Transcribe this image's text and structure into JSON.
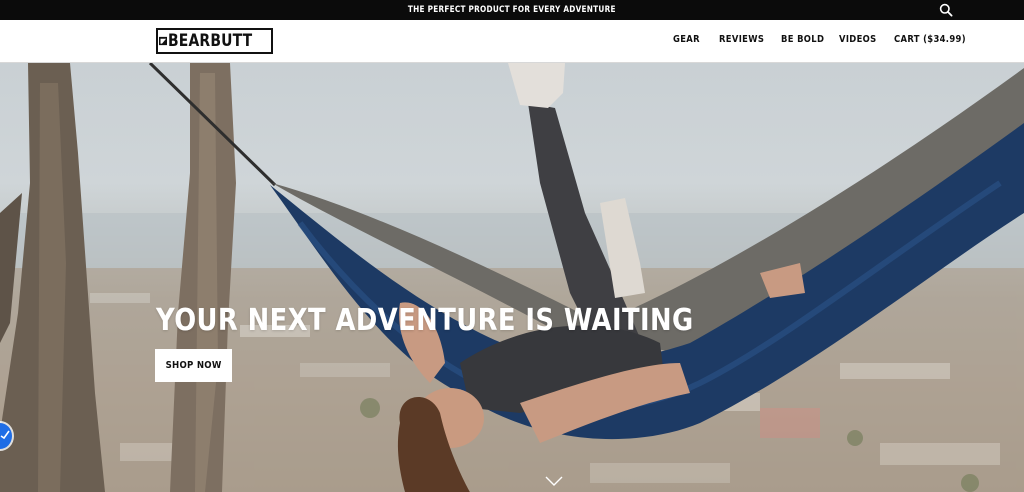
{
  "topbar": {
    "promo_text": "THE PERFECT PRODUCT FOR EVERY ADVENTURE",
    "search_icon": "search-icon",
    "background": "#0b0b0b"
  },
  "header": {
    "logo_text": "BEARBUTT",
    "nav": [
      {
        "label": "GEAR"
      },
      {
        "label": "REVIEWS"
      },
      {
        "label": "BE BOLD"
      },
      {
        "label": "VIDEOS"
      },
      {
        "label": "CART ($34.99)"
      }
    ]
  },
  "hero": {
    "headline": "YOUR NEXT ADVENTURE IS WAITING",
    "cta_label": "SHOP NOW",
    "scroll_icon": "chevron-down-icon",
    "hammock_color": "#1d3a64"
  },
  "side_widget": {
    "icon": "check-icon",
    "color": "#1f6de6"
  }
}
